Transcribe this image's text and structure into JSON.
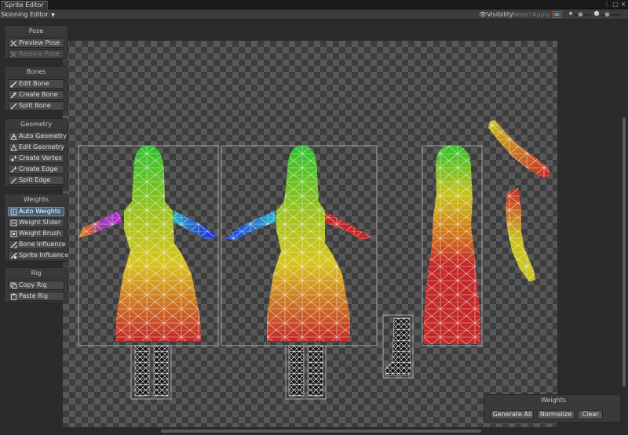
{
  "window": {
    "tab_title": "Sprite Editor"
  },
  "toolbar": {
    "mode": "Skinning Editor",
    "visibility_label": "Visibility",
    "revert_label": "Revert",
    "apply_label": "Apply"
  },
  "panels": {
    "pose": {
      "title": "Pose",
      "buttons": [
        {
          "label": "Preview Pose",
          "icon": "preview-pose-icon"
        },
        {
          "label": "Restore Pose",
          "icon": "restore-pose-icon"
        }
      ]
    },
    "bones": {
      "title": "Bones",
      "buttons": [
        {
          "label": "Edit Bone",
          "icon": "edit-bone-icon"
        },
        {
          "label": "Create Bone",
          "icon": "create-bone-icon"
        },
        {
          "label": "Split Bone",
          "icon": "split-bone-icon"
        }
      ]
    },
    "geometry": {
      "title": "Geometry",
      "buttons": [
        {
          "label": "Auto Geometry",
          "icon": "auto-geometry-icon"
        },
        {
          "label": "Edit Geometry",
          "icon": "edit-geometry-icon"
        },
        {
          "label": "Create Vertex",
          "icon": "create-vertex-icon"
        },
        {
          "label": "Create Edge",
          "icon": "create-edge-icon"
        },
        {
          "label": "Split Edge",
          "icon": "split-edge-icon"
        }
      ]
    },
    "weights": {
      "title": "Weights",
      "buttons": [
        {
          "label": "Auto Weights",
          "icon": "auto-weights-icon"
        },
        {
          "label": "Weight Slider",
          "icon": "weight-slider-icon"
        },
        {
          "label": "Weight Brush",
          "icon": "weight-brush-icon"
        },
        {
          "label": "Bone Influence",
          "icon": "bone-influence-icon"
        },
        {
          "label": "Sprite Influence",
          "icon": "sprite-influence-icon"
        }
      ]
    },
    "rig": {
      "title": "Rig",
      "buttons": [
        {
          "label": "Copy Rig",
          "icon": "copy-rig-icon"
        },
        {
          "label": "Paste Rig",
          "icon": "paste-rig-icon"
        }
      ]
    }
  },
  "weights_window": {
    "title": "Weights",
    "generate_all": "Generate All",
    "normalize": "Normalize",
    "clear": "Clear"
  },
  "colors": {
    "bone_red": "#c62828",
    "bone_green": "#2fc12f",
    "bone_yellow": "#c9c21f",
    "bone_orange": "#d2761c",
    "bone_blue": "#1c2bd6",
    "bone_magenta": "#b02bc2",
    "bone_cyan": "#2ab3c6",
    "selected_tool": "#46607c"
  }
}
